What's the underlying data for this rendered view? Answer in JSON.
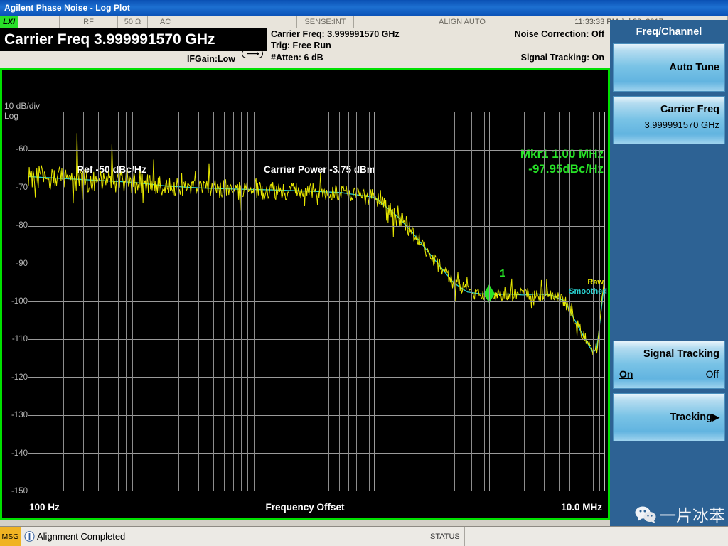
{
  "window": {
    "title": "Agilent Phase Noise - Log Plot"
  },
  "status_strip": {
    "lxi": "LXI",
    "rf": "RF",
    "impedance": "50 Ω",
    "coupling": "AC",
    "sense": "SENSE:INT",
    "align": "ALIGN AUTO",
    "datetime": "11:33:33 PM Jul 29, 2017"
  },
  "carrier_banner": {
    "text": "Carrier Freq 3.999991570 GHz"
  },
  "settings": {
    "carrier_freq": "Carrier Freq: 3.999991570 GHz",
    "trig": "Trig: Free Run",
    "atten": "#Atten: 6 dB",
    "noise_correction": "Noise Correction: Off",
    "signal_tracking": "Signal Tracking: On",
    "ifgain": "IFGain:Low"
  },
  "plot": {
    "db_per_div": "10 dB/div",
    "scale_type": "Log",
    "ref_label": "Ref  -50 dBc/Hz",
    "carrier_power": "Carrier Power -3.75 dBm",
    "marker_freq": "Mkr1 1.00 MHz",
    "marker_level": "-97.95dBc/Hz",
    "marker_number": "1",
    "x_start": "100 Hz",
    "x_title": "Frequency Offset",
    "x_stop": "10.0 MHz",
    "legend_raw": "Raw",
    "legend_smoothed": "Smoothed",
    "colors": {
      "raw": "#e8e800",
      "smoothed": "#2ad2d2",
      "marker": "#27e327",
      "border": "#00e000",
      "grid": "#9a9a9a",
      "background": "#000000"
    }
  },
  "chart_data": {
    "type": "line",
    "title": "Phase Noise - Log Plot",
    "xlabel": "Frequency Offset",
    "ylabel": "dBc/Hz",
    "xscale": "log",
    "xlim": [
      100,
      10000000
    ],
    "ylim": [
      -150,
      -50
    ],
    "ytick_step": 10,
    "yticks": [
      -60,
      -70,
      -80,
      -90,
      -100,
      -110,
      -120,
      -130,
      -140,
      -150
    ],
    "grid": true,
    "legend_position": "right-inside",
    "reference_level": -50,
    "db_per_div": 10,
    "annotations": [
      {
        "label": "Mkr1",
        "x": 1000000,
        "y": -97.95,
        "text": "Mkr1 1.00 MHz  -97.95dBc/Hz"
      },
      {
        "label": "Carrier Power",
        "text": "-3.75 dBm"
      }
    ],
    "series": [
      {
        "name": "Raw",
        "color": "#e8e800",
        "x": [
          100,
          115,
          132,
          152,
          174,
          200,
          230,
          265,
          305,
          350,
          400,
          460,
          530,
          610,
          700,
          800,
          920,
          1060,
          1220,
          1400,
          1610,
          1850,
          2130,
          2450,
          2810,
          3230,
          3720,
          4270,
          4910,
          5640,
          6490,
          7460,
          8580,
          9860,
          11300,
          13000,
          15000,
          17200,
          19800,
          22800,
          26200,
          30100,
          34600,
          39800,
          45700,
          52500,
          60400,
          69400,
          79800,
          91700,
          105000,
          121000,
          139000,
          160000,
          184000,
          212000,
          243000,
          280000,
          322000,
          370000,
          425000,
          489000,
          562000,
          646000,
          743000,
          854000,
          982000,
          1130000,
          1300000,
          1490000,
          1710000,
          1970000,
          2270000,
          2610000,
          3000000,
          3450000,
          3960000,
          4550000,
          5240000,
          6020000,
          6920000,
          7960000,
          8500000,
          9000000,
          9500000,
          9900000,
          10000000
        ],
        "y": [
          -65.5,
          -70.5,
          -64.0,
          -71.0,
          -67.0,
          -73.5,
          -68.0,
          -55.5,
          -66.0,
          -71.5,
          -64.5,
          -70.5,
          -58.5,
          -69.0,
          -65.5,
          -72.5,
          -67.0,
          -70.5,
          -62.5,
          -71.0,
          -67.5,
          -73.0,
          -66.0,
          -70.5,
          -68.5,
          -72.0,
          -63.5,
          -71.5,
          -68.0,
          -74.0,
          -67.0,
          -71.0,
          -69.5,
          -72.5,
          -66.5,
          -71.0,
          -68.0,
          -73.0,
          -67.5,
          -70.0,
          -69.0,
          -72.0,
          -66.0,
          -70.5,
          -68.5,
          -71.5,
          -67.0,
          -70.0,
          -73.5,
          -66.5,
          -70.5,
          -72.0,
          -74.5,
          -76.5,
          -79.0,
          -81.5,
          -83.0,
          -86.0,
          -88.5,
          -90.5,
          -92.5,
          -95.0,
          -96.5,
          -93.5,
          -99.0,
          -97.5,
          -98.0,
          -97.9,
          -99.5,
          -97.0,
          -98.5,
          -96.5,
          -98.0,
          -97.5,
          -99.0,
          -98.5,
          -100.0,
          -102.5,
          -105.5,
          -109.0,
          -112.5,
          -115.0,
          -114.0,
          -112.0,
          -97.0,
          -93.5,
          -93.0
        ]
      },
      {
        "name": "Smoothed",
        "color": "#2ad2d2",
        "x": [
          100,
          200,
          400,
          800,
          1600,
          3200,
          6400,
          12800,
          25600,
          51200,
          102000,
          160000,
          212000,
          280000,
          370000,
          489000,
          646000,
          854000,
          1130000,
          1490000,
          1970000,
          2610000,
          3450000,
          4550000,
          6020000,
          7960000,
          9000000,
          10000000
        ],
        "y": [
          -67.0,
          -67.5,
          -68.0,
          -68.5,
          -69.5,
          -70.0,
          -70.3,
          -70.5,
          -70.8,
          -71.2,
          -72.5,
          -77.5,
          -81.5,
          -86.0,
          -90.5,
          -95.0,
          -97.5,
          -98.0,
          -98.2,
          -98.0,
          -98.3,
          -98.0,
          -98.3,
          -100.0,
          -107.0,
          -113.5,
          -112.0,
          -95.0
        ]
      }
    ]
  },
  "softkeys": {
    "title": "Freq/Channel",
    "items": [
      {
        "label": "Auto Tune",
        "type": "button"
      },
      {
        "label": "Carrier Freq",
        "value": "3.999991570 GHz",
        "type": "value"
      },
      {
        "label": "Signal Tracking",
        "on": "On",
        "off": "Off",
        "type": "onoff"
      },
      {
        "label": "Tracking",
        "arrow": "▶",
        "type": "menu"
      }
    ]
  },
  "watermark": {
    "text": "一片冰苯"
  },
  "message_bar": {
    "tag": "MSG",
    "text": "Alignment Completed",
    "status": "STATUS"
  }
}
